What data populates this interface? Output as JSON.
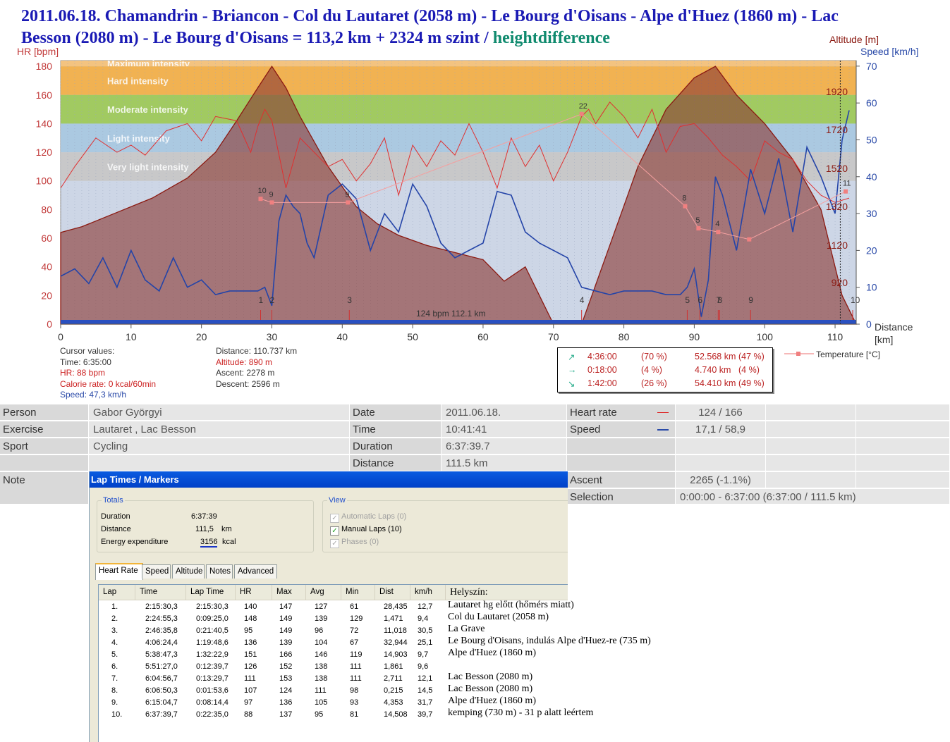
{
  "title": {
    "main": "2011.06.18. Chamandrin - Briancon - Col du Lautaret (2058 m) - Le Bourg d'Oisans - Alpe d'Huez (1860 m) - Lac Besson (2080 m) - Le Bourg d'Oisans = 113,2 km + 2324 m szint / ",
    "highlight": "heightdifference"
  },
  "chart_data": {
    "type": "line",
    "xlabel": "Distance [km]",
    "ylabel_left": "HR [bpm]",
    "ylabel_right_altitude": "Altitude [m]",
    "ylabel_right_speed": "Speed [km/h]",
    "xlim": [
      0,
      113
    ],
    "ylim_hr": [
      0,
      180
    ],
    "ylim_speed": [
      0,
      70
    ],
    "x_ticks": [
      "0",
      "10",
      "20",
      "30",
      "40",
      "50",
      "60",
      "70",
      "80",
      "90",
      "100",
      "110"
    ],
    "hr_ticks": [
      "0",
      "20",
      "40",
      "60",
      "80",
      "100",
      "120",
      "140",
      "160",
      "180"
    ],
    "speed_ticks": [
      "0",
      "10",
      "20",
      "30",
      "40",
      "50",
      "60",
      "70"
    ],
    "altitude_ticks": [
      "920",
      "1120",
      "1320",
      "1520",
      "1720",
      "1920"
    ],
    "zones": [
      {
        "name": "Maximum intensity",
        "from": 180,
        "to": 190,
        "color": "#f4c27a"
      },
      {
        "name": "Hard intensity",
        "from": 160,
        "to": 180,
        "color": "#f2b04a"
      },
      {
        "name": "Moderate intensity",
        "from": 140,
        "to": 160,
        "color": "#9ec95a"
      },
      {
        "name": "Light intensity",
        "from": 120,
        "to": 140,
        "color": "#a9c8e0"
      },
      {
        "name": "Very light intensity",
        "from": 100,
        "to": 120,
        "color": "#c7c7c7"
      }
    ],
    "altitude": {
      "x": [
        0,
        3,
        8,
        13,
        18,
        22,
        25,
        28,
        30,
        32,
        34,
        38,
        42,
        45,
        48,
        52,
        56,
        60,
        63,
        66,
        70,
        74,
        78,
        82,
        86,
        90,
        93,
        96,
        100,
        104,
        108,
        111,
        113
      ],
      "y": [
        64,
        68,
        78,
        88,
        102,
        120,
        142,
        165,
        180,
        165,
        145,
        110,
        82,
        70,
        62,
        55,
        50,
        45,
        30,
        40,
        0,
        0,
        55,
        110,
        150,
        172,
        180,
        160,
        140,
        115,
        80,
        20,
        0
      ]
    },
    "hr": {
      "x": [
        0,
        2,
        5,
        8,
        10,
        12,
        15,
        18,
        20,
        22,
        25,
        27,
        28,
        29,
        30,
        32,
        34,
        36,
        38,
        40,
        42,
        44,
        46,
        48,
        50,
        52,
        54,
        56,
        58,
        60,
        62,
        64,
        66,
        68,
        70,
        72,
        74,
        75,
        76,
        78,
        80,
        82,
        84,
        86,
        88,
        90,
        92,
        94,
        96,
        98,
        100,
        102,
        104,
        106,
        108,
        110,
        112
      ],
      "y": [
        95,
        110,
        130,
        120,
        125,
        118,
        135,
        140,
        128,
        145,
        142,
        120,
        138,
        150,
        142,
        95,
        130,
        120,
        110,
        115,
        100,
        112,
        130,
        90,
        125,
        110,
        128,
        118,
        140,
        120,
        95,
        130,
        110,
        125,
        100,
        120,
        145,
        150,
        140,
        155,
        145,
        130,
        150,
        120,
        138,
        140,
        130,
        118,
        110,
        100,
        128,
        120,
        115,
        100,
        90,
        85,
        88
      ]
    },
    "speed": {
      "x": [
        0,
        2,
        4,
        6,
        8,
        10,
        12,
        14,
        16,
        18,
        20,
        22,
        24,
        26,
        28,
        29,
        30,
        31,
        32,
        33,
        34,
        35,
        36,
        38,
        40,
        42,
        44,
        46,
        48,
        50,
        52,
        54,
        56,
        58,
        60,
        62,
        64,
        66,
        68,
        70,
        72,
        74,
        76,
        78,
        80,
        82,
        84,
        86,
        88,
        89,
        90,
        91,
        92,
        93,
        94,
        96,
        98,
        100,
        102,
        104,
        106,
        108,
        110,
        111,
        112
      ],
      "y": [
        13,
        15,
        11,
        18,
        10,
        20,
        12,
        9,
        18,
        10,
        12,
        8,
        9,
        9,
        9,
        10,
        5,
        28,
        35,
        32,
        30,
        22,
        18,
        35,
        38,
        34,
        20,
        30,
        25,
        38,
        32,
        22,
        18,
        20,
        22,
        36,
        35,
        25,
        22,
        20,
        18,
        10,
        9,
        8,
        9,
        9,
        9,
        8,
        8,
        10,
        15,
        2,
        12,
        40,
        35,
        20,
        42,
        30,
        45,
        25,
        48,
        40,
        30,
        50,
        58
      ]
    },
    "temperature": {
      "name": "Temperature [°C]",
      "x": [
        28.4,
        30,
        40.8,
        74,
        88.7,
        90.6,
        93.4,
        97.8,
        111.5
      ],
      "y": [
        34,
        33,
        33,
        57,
        32,
        26,
        25,
        23,
        36
      ],
      "labels": [
        "10",
        "9",
        "9",
        "22",
        "8",
        "5",
        "4",
        "",
        "11"
      ]
    },
    "laps_markers": [
      {
        "x": 28.4,
        "label": "1"
      },
      {
        "x": 30,
        "label": "2"
      },
      {
        "x": 41,
        "label": "3"
      },
      {
        "x": 74,
        "label": "4"
      },
      {
        "x": 89,
        "label": "5"
      },
      {
        "x": 90.8,
        "label": "6"
      },
      {
        "x": 93.4,
        "label": "7"
      },
      {
        "x": 93.6,
        "label": "8"
      },
      {
        "x": 98,
        "label": "9"
      },
      {
        "x": 112.5,
        "label": "10"
      }
    ],
    "footer_text": "124 bpm 112.1 km"
  },
  "cursor": {
    "header": "Cursor values:",
    "time": "Time: 6:35:00",
    "hr": "HR: 88 bpm",
    "calorie": "Calorie rate: 0 kcal/60min",
    "speed": "Speed: 47,3 km/h",
    "distance": "Distance: 110.737 km",
    "altitude": "Altitude: 890 m",
    "ascent": "Ascent: 2278 m",
    "descent": "Descent: 2596 m"
  },
  "slope": [
    {
      "arrow": "↗",
      "time": "4:36:00",
      "tpct": "(70 %)",
      "dist": "52.568 km",
      "dpct": "(47 %)",
      "color": "#2a8"
    },
    {
      "arrow": "→",
      "time": "0:18:00",
      "tpct": "(4 %)",
      "dist": "4.740 km",
      "dpct": "(4 %)",
      "color": "#2a8"
    },
    {
      "arrow": "↘",
      "time": "1:42:00",
      "tpct": "(26 %)",
      "dist": "54.410 km",
      "dpct": "(49 %)",
      "color": "#2a8"
    }
  ],
  "temp_legend": "Temperature [°C]",
  "info": {
    "person_l": "Person",
    "person": "Gabor Györgyi",
    "exercise_l": "Exercise",
    "exercise": "Lautaret , Lac Besson",
    "sport_l": "Sport",
    "sport": "Cycling",
    "note_l": "Note",
    "date_l": "Date",
    "date": "2011.06.18.",
    "time_l": "Time",
    "time": "10:41:41",
    "duration_l": "Duration",
    "duration": "6:37:39.7",
    "distance_l": "Distance",
    "distance": "111.5 km",
    "hr_l": "Heart rate",
    "hr": "124 / 166",
    "speed_l": "Speed",
    "speed": "17,1 / 58,9",
    "ascent_l": "Ascent",
    "ascent": "2265 (-1.1%)",
    "selection_l": "Selection",
    "selection": "0:00:00 - 6:37:00 (6:37:00 / 111.5 km)"
  },
  "panel": {
    "title": "Lap Times / Markers",
    "totals_legend": "Totals",
    "duration_l": "Duration",
    "duration": "6:37:39",
    "distance_l": "Distance",
    "distance": "111,5",
    "distance_u": "km",
    "energy_l": "Energy expenditure",
    "energy": "3156",
    "energy_u": "kcal",
    "view_legend": "View",
    "auto_laps": "Automatic Laps (0)",
    "manual_laps": "Manual Laps (10)",
    "phases": "Phases (0)",
    "tabs": [
      "Heart Rate",
      "Speed",
      "Altitude",
      "Notes",
      "Advanced"
    ],
    "columns": [
      "Lap",
      "Time",
      "Lap Time",
      "HR",
      "Max",
      "Avg",
      "Min",
      "Dist",
      "km/h",
      "Helyszín:"
    ],
    "rows": [
      [
        "1.",
        "2:15:30,3",
        "2:15:30,3",
        "140",
        "147",
        "127",
        "61",
        "28,435",
        "12,7",
        "Lautaret hg előtt (hőmérs miatt)"
      ],
      [
        "2.",
        "2:24:55,3",
        "0:09:25,0",
        "148",
        "149",
        "139",
        "129",
        "1,471",
        "9,4",
        "Col du Lautaret (2058 m)"
      ],
      [
        "3.",
        "2:46:35,8",
        "0:21:40,5",
        "95",
        "149",
        "96",
        "72",
        "11,018",
        "30,5",
        "La Grave"
      ],
      [
        "4.",
        "4:06:24,4",
        "1:19:48,6",
        "136",
        "139",
        "104",
        "67",
        "32,944",
        "25,1",
        "Le Bourg d'Oisans, indulás Alpe d'Huez-re (735 m)"
      ],
      [
        "5.",
        "5:38:47,3",
        "1:32:22,9",
        "151",
        "166",
        "146",
        "119",
        "14,903",
        "9,7",
        "Alpe d'Huez (1860 m)"
      ],
      [
        "6.",
        "5:51:27,0",
        "0:12:39,7",
        "126",
        "152",
        "138",
        "111",
        "1,861",
        "9,6",
        ""
      ],
      [
        "7.",
        "6:04:56,7",
        "0:13:29,7",
        "111",
        "153",
        "138",
        "111",
        "2,711",
        "12,1",
        "Lac Besson (2080 m)"
      ],
      [
        "8.",
        "6:06:50,3",
        "0:01:53,6",
        "107",
        "124",
        "111",
        "98",
        "0,215",
        "14,5",
        "Lac Besson (2080 m)"
      ],
      [
        "9.",
        "6:15:04,7",
        "0:08:14,4",
        "97",
        "136",
        "105",
        "93",
        "4,353",
        "31,7",
        "Alpe d'Huez (1860 m)"
      ],
      [
        "10.",
        "6:37:39,7",
        "0:22:35,0",
        "88",
        "137",
        "95",
        "81",
        "14,508",
        "39,7",
        "kemping (730 m)  - 31 p alatt leértem"
      ]
    ]
  }
}
